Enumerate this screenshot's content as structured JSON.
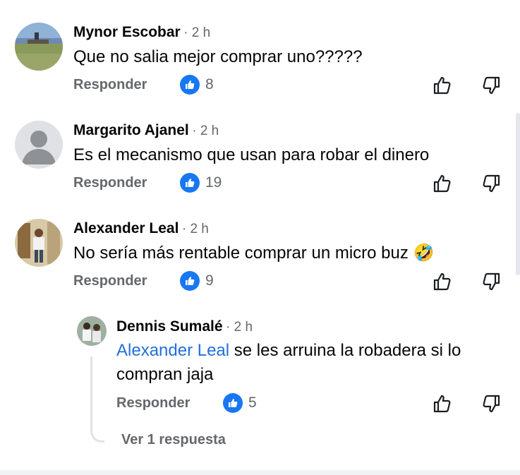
{
  "comments": [
    {
      "author": "Mynor Escobar",
      "time": "· 2 h",
      "text": "Que no salia mejor comprar uno?????",
      "reply_label": "Responder",
      "likes": "8",
      "avatar": "landscape-photo"
    },
    {
      "author": "Margarito Ajanel",
      "time": "· 2 h",
      "text": "Es el mecanismo que usan para robar el dinero",
      "reply_label": "Responder",
      "likes": "19",
      "avatar": "default-person"
    },
    {
      "author": "Alexander Leal",
      "time": "· 2 h",
      "text": "No sería más rentable comprar un micro buz 🤣",
      "reply_label": "Responder",
      "likes": "9",
      "avatar": "person-photo"
    }
  ],
  "reply": {
    "author": "Dennis Sumalé",
    "time": "· 2 h",
    "mention": "Alexander Leal",
    "text_line1": " se les arruina la robadera si lo",
    "text_line2": "compran jaja",
    "reply_label": "Responder",
    "likes": "5",
    "avatar": "two-people-photo"
  },
  "view_replies": "Ver 1 respuesta",
  "icons": {
    "like_badge": "thumbs-up-icon",
    "upvote": "thumb-up-outline-icon",
    "downvote": "thumb-down-outline-icon"
  },
  "colors": {
    "like_blue": "#1877f2",
    "mention_blue": "#216fdb",
    "secondary_text": "#65676b"
  }
}
